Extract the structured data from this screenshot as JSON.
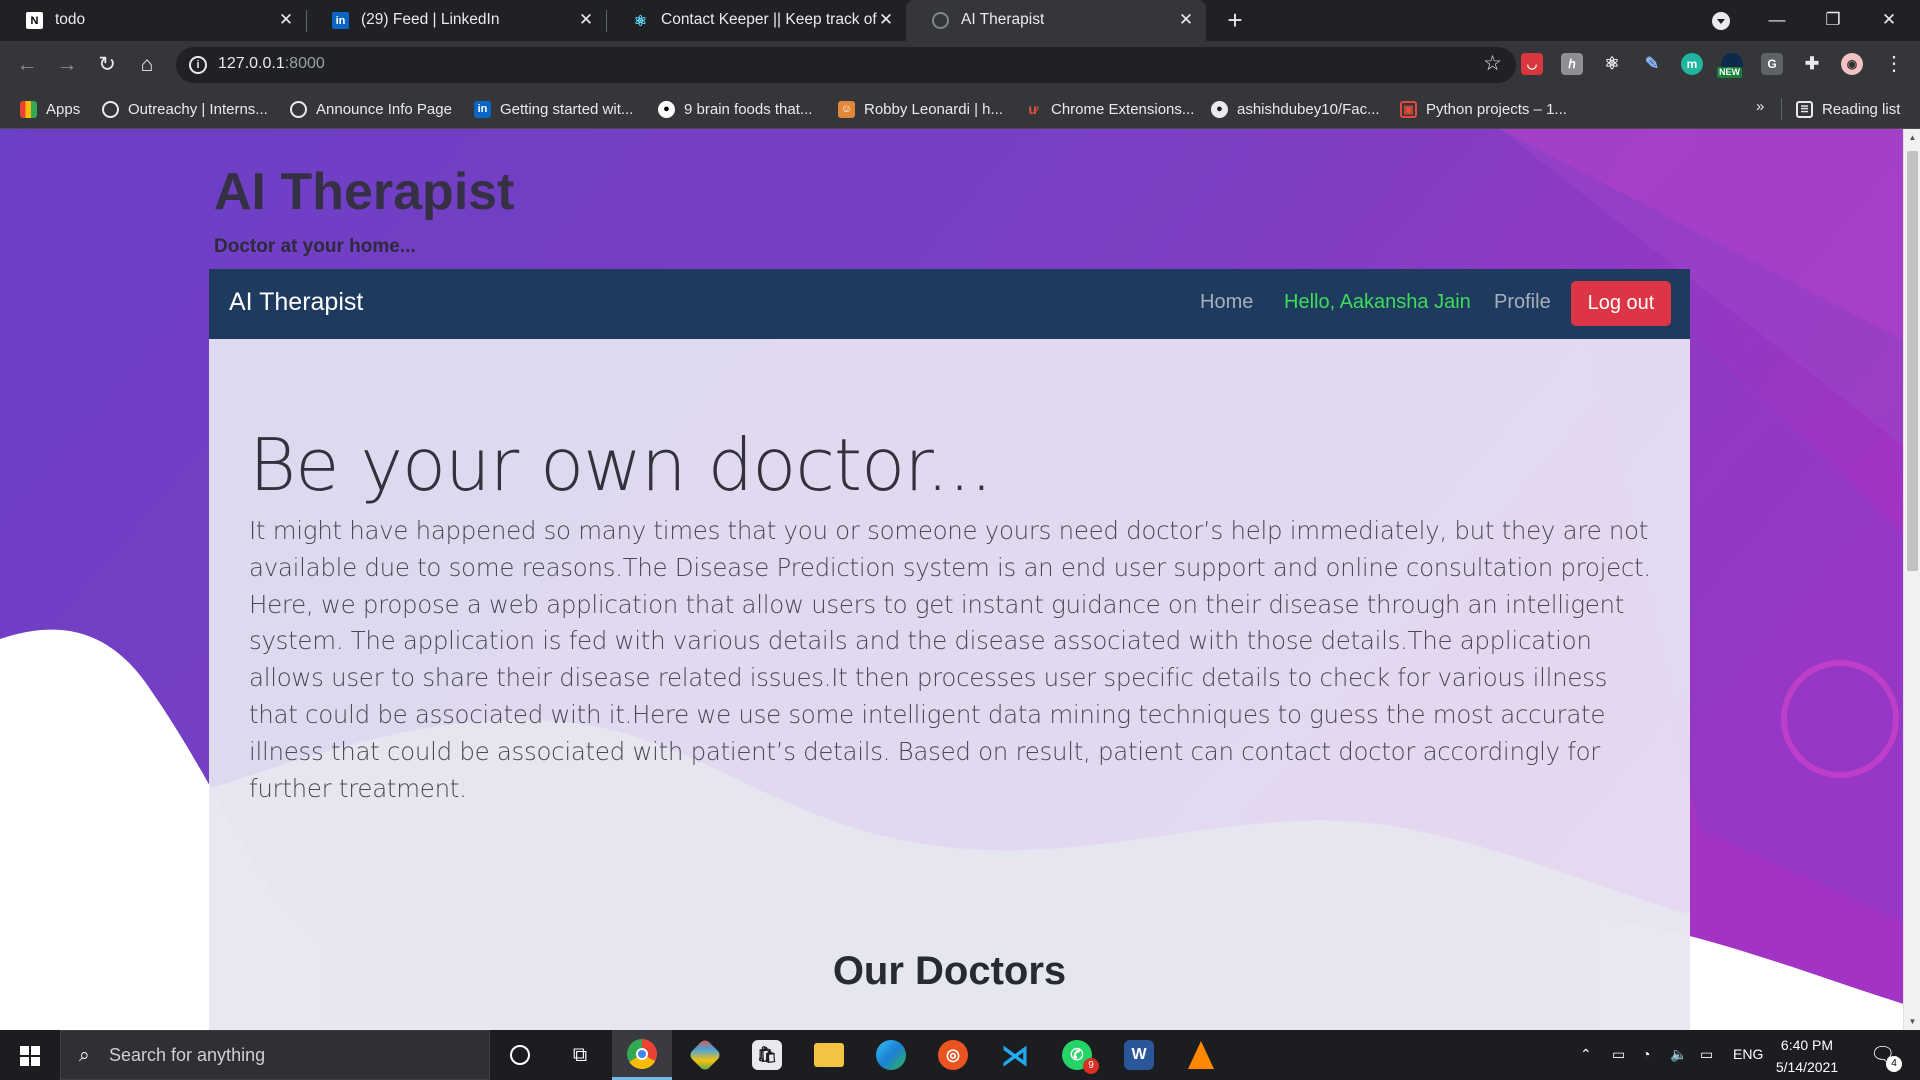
{
  "browser": {
    "tabs": [
      {
        "title": "todo",
        "icon": "notion-icon"
      },
      {
        "title": "(29) Feed | LinkedIn",
        "icon": "linkedin-icon"
      },
      {
        "title": "Contact Keeper || Keep track of y",
        "icon": "react-icon"
      },
      {
        "title": "AI Therapist",
        "icon": "globe-icon",
        "active": true
      }
    ],
    "url_host": "127.0.0.1",
    "url_port": ":8000",
    "bookmarks": [
      "Apps",
      "Outreachy | Interns...",
      "Announce Info Page",
      "Getting started wit...",
      "9 brain foods that...",
      "Robby Leonardi | h...",
      "Chrome Extensions...",
      "ashishdubey10/Fac...",
      "Python projects – 1..."
    ],
    "bookmarks_more": "»",
    "reading_list": "Reading list",
    "extension_new_badge": "NEW"
  },
  "site": {
    "title": "AI Therapist",
    "tagline": "Doctor at your home..."
  },
  "navbar": {
    "brand": "AI Therapist",
    "home": "Home",
    "greeting": "Hello, Aakansha Jain",
    "profile": "Profile",
    "logout": "Log out"
  },
  "hero": {
    "title": "Be your own doctor...",
    "description": "It might have happened so many times that you or someone yours need doctor’s help immediately, but they are not available due to some reasons.The Disease Prediction system is an end user support and online consultation project. Here, we propose a web application that allow users to get instant guidance on their disease through an intelligent system. The application is fed with various details and the disease associated with those details.The application allows user to share their disease related issues.It then processes user specific details to check for various illness that could be associated with it.Here we use some intelligent data mining techniques to guess the most accurate illness that could be associated with patient’s details. Based on result, patient can contact doctor accordingly for further treatment."
  },
  "doctors_section": {
    "title": "Our Doctors"
  },
  "taskbar": {
    "search_placeholder": "Search for anything",
    "whatsapp_badge": "9",
    "language": "ENG",
    "time": "6:40 PM",
    "date": "5/14/2021",
    "notifications": "4"
  },
  "colors": {
    "navbar_bg": "#1f3a5f",
    "greeting": "#3ddc59",
    "logout_bg": "#dc3545",
    "page_bg_purple": "#6a3cc4"
  }
}
